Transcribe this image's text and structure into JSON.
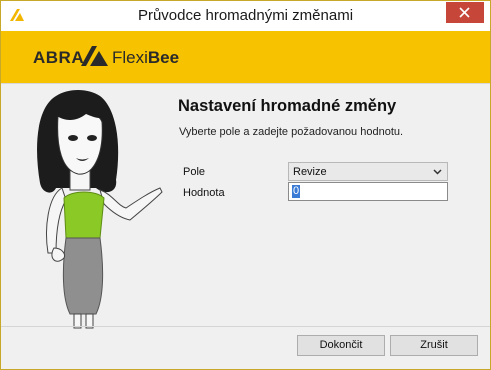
{
  "window": {
    "title": "Průvodce hromadnými změnami",
    "icon": "abra-app-icon"
  },
  "banner": {
    "logo_abra": "ABRA",
    "logo_flexi": "Flexi",
    "logo_bee": "Bee"
  },
  "main": {
    "heading": "Nastavení hromadné změny",
    "subtitle": "Vyberte pole a zadejte požadovanou hodnotu.",
    "field_label": "Pole",
    "field_value": "Revize",
    "value_label": "Hodnota",
    "value_input": "0"
  },
  "footer": {
    "finish_label": "Dokončit",
    "cancel_label": "Zrušit"
  },
  "colors": {
    "banner": "#f7c200",
    "close_button": "#c7463a",
    "accent_top": "#8ac926"
  }
}
